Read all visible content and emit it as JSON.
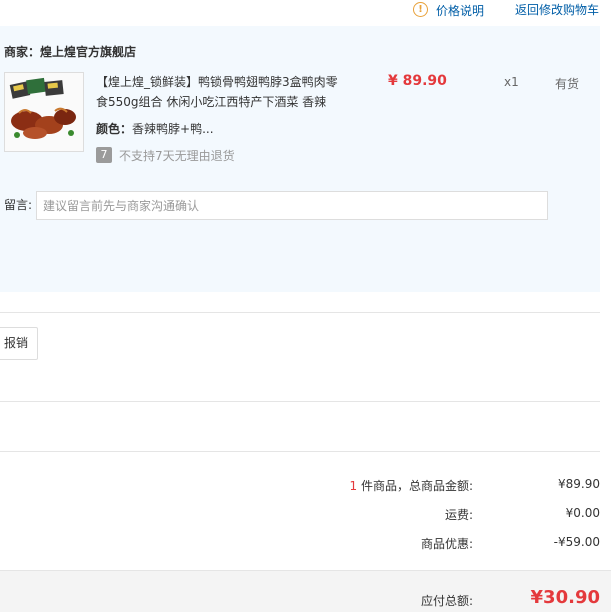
{
  "topbar": {
    "warn_icon": "exclamation-circle-icon",
    "warn_glyph": "!",
    "price_explain": "价格说明",
    "back_to_cart": "返回修改购物车"
  },
  "shop": {
    "merchant": "商家：煌上煌官方旗舰店",
    "product": {
      "title": "【煌上煌_锁鲜装】鸭锁骨鸭翅鸭脖3盒鸭肉零食550g组合 休闲小吃江西特产下酒菜 香辣",
      "price": "¥ 89.90",
      "qty": "x1",
      "stock": "有货",
      "color_label": "颜色：",
      "color_value": "香辣鸭脖+鸭...",
      "no_return_icon_glyph": "7",
      "no_return_text": "不支持7天无理由退货"
    },
    "remark": {
      "label": "留言:",
      "placeholder": "建议留言前先与商家沟通确认"
    }
  },
  "invoice": {
    "reimburse_label": "报销"
  },
  "summary": {
    "count": "1",
    "count_suffix": " 件商品，总商品金额:",
    "goods_total": "¥89.90",
    "shipping_label": "运费:",
    "shipping": "¥0.00",
    "discount_label": "商品优惠:",
    "discount": "-¥59.00",
    "total_label": "应付总额:",
    "total": "¥30.90"
  },
  "colors": {
    "link": "#005ea7",
    "price_red": "#e4393c",
    "panel_bg": "#f3f9fe"
  }
}
